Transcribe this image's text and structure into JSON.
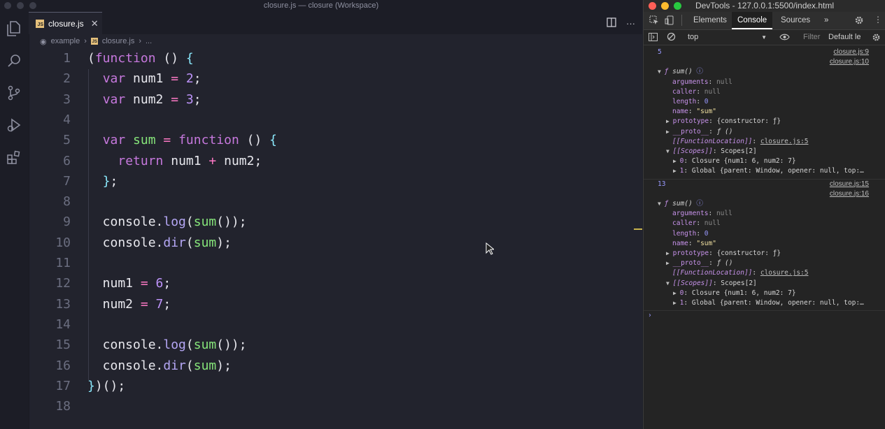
{
  "window": {
    "title": "closure.js — closure (Workspace)"
  },
  "tab": {
    "label": "closure.js",
    "icon": "JS"
  },
  "breadcrumb": {
    "folder": "example",
    "file": "closure.js",
    "more": "..."
  },
  "code_lines": [
    {
      "n": "1",
      "text": "(function () {"
    },
    {
      "n": "2",
      "text": "  var num1 = 2;"
    },
    {
      "n": "3",
      "text": "  var num2 = 3;"
    },
    {
      "n": "4",
      "text": ""
    },
    {
      "n": "5",
      "text": "  var sum = function () {"
    },
    {
      "n": "6",
      "text": "    return num1 + num2;"
    },
    {
      "n": "7",
      "text": "  };"
    },
    {
      "n": "8",
      "text": ""
    },
    {
      "n": "9",
      "text": "  console.log(sum());"
    },
    {
      "n": "10",
      "text": "  console.dir(sum);"
    },
    {
      "n": "11",
      "text": ""
    },
    {
      "n": "12",
      "text": "  num1 = 6;"
    },
    {
      "n": "13",
      "text": "  num2 = 7;"
    },
    {
      "n": "14",
      "text": ""
    },
    {
      "n": "15",
      "text": "  console.log(sum());"
    },
    {
      "n": "16",
      "text": "  console.dir(sum);"
    },
    {
      "n": "17",
      "text": "})();"
    },
    {
      "n": "18",
      "text": ""
    }
  ],
  "devtools": {
    "title": "DevTools - 127.0.0.1:5500/index.html",
    "tabs": [
      "Elements",
      "Console",
      "Sources",
      "»"
    ],
    "context": "top",
    "filter_placeholder": "Filter",
    "levels": "Default le",
    "log1": {
      "value": "5",
      "source": "closure.js:9"
    },
    "dir1_source": "closure.js:10",
    "log2": {
      "value": "13",
      "source": "closure.js:15"
    },
    "dir2_source": "closure.js:16",
    "fn_header": "sum()",
    "props": {
      "arguments": "arguments",
      "null": "null",
      "caller": "caller",
      "length": "length",
      "length_val": "0",
      "name": "name",
      "name_val": "\"sum\"",
      "prototype": "prototype",
      "prototype_val": "{constructor: ƒ}",
      "proto": "__proto__",
      "proto_val": "ƒ ()",
      "fnloc": "[[FunctionLocation]]",
      "fnloc_val": "closure.js:5",
      "scopes": "[[Scopes]]",
      "scopes_val": "Scopes[2]",
      "closure": "0",
      "closure_val": "Closure {num1: 6, num2: 7}",
      "global": "1",
      "global_val": "Global {parent: Window, opener: null, top:…"
    },
    "prompt": "›"
  }
}
